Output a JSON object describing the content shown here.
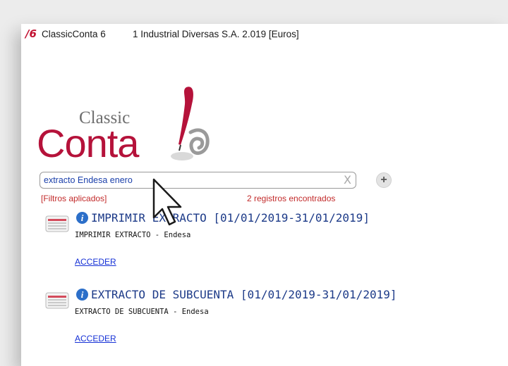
{
  "titlebar": {
    "app_name": "ClassicConta 6",
    "company": "1 Industrial Diversas S.A. 2.019 [Euros]"
  },
  "logo": {
    "classic": "Classic",
    "conta": "Conta",
    "version": "6"
  },
  "search": {
    "value": "extracto Endesa enero",
    "clear_label": "X",
    "add_label": "+"
  },
  "filters_label": "[Filtros aplicados]",
  "results_count": "2 registros encontrados",
  "results": [
    {
      "title": "IMPRIMIR EXTRACTO [01/01/2019-31/01/2019]",
      "subtitle": "IMPRIMIR EXTRACTO - Endesa",
      "link": "ACCEDER"
    },
    {
      "title": "EXTRACTO DE SUBCUENTA [01/01/2019-31/01/2019]",
      "subtitle": "EXTRACTO DE SUBCUENTA - Endesa",
      "link": "ACCEDER"
    }
  ],
  "colors": {
    "brand_red": "#b5123a",
    "title_blue": "#1c3a88",
    "link_blue": "#1530d6",
    "notice_red": "#c22a2a"
  }
}
